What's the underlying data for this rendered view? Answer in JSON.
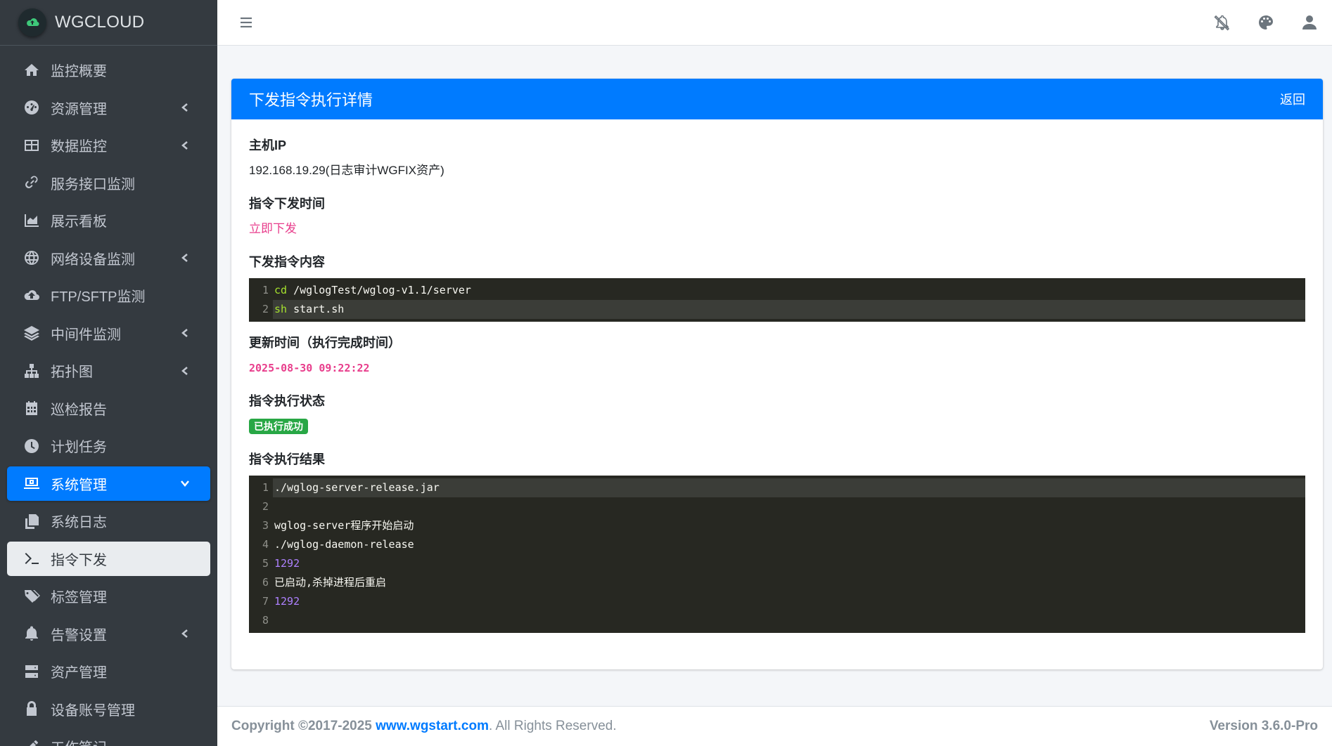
{
  "brand": {
    "name": "WGCLOUD"
  },
  "sidebar": {
    "items": [
      {
        "label": "监控概要",
        "icon": "home-icon",
        "arrow": false,
        "state": ""
      },
      {
        "label": "资源管理",
        "icon": "gauge-icon",
        "arrow": true,
        "state": ""
      },
      {
        "label": "数据监控",
        "icon": "table-icon",
        "arrow": true,
        "state": ""
      },
      {
        "label": "服务接口监测",
        "icon": "link-icon",
        "arrow": false,
        "state": ""
      },
      {
        "label": "展示看板",
        "icon": "area-chart-icon",
        "arrow": false,
        "state": ""
      },
      {
        "label": "网络设备监测",
        "icon": "globe-icon",
        "arrow": true,
        "state": ""
      },
      {
        "label": "FTP/SFTP监测",
        "icon": "cloud-upload-icon",
        "arrow": false,
        "state": ""
      },
      {
        "label": "中间件监测",
        "icon": "layers-icon",
        "arrow": true,
        "state": ""
      },
      {
        "label": "拓扑图",
        "icon": "sitemap-icon",
        "arrow": true,
        "state": ""
      },
      {
        "label": "巡检报告",
        "icon": "calendar-icon",
        "arrow": false,
        "state": ""
      },
      {
        "label": "计划任务",
        "icon": "clock-icon",
        "arrow": false,
        "state": ""
      },
      {
        "label": "系统管理",
        "icon": "laptop-icon",
        "arrow": true,
        "state": "active"
      },
      {
        "label": "系统日志",
        "icon": "copy-icon",
        "arrow": false,
        "state": ""
      },
      {
        "label": "指令下发",
        "icon": "terminal-icon",
        "arrow": false,
        "state": "current"
      },
      {
        "label": "标签管理",
        "icon": "tags-icon",
        "arrow": false,
        "state": ""
      },
      {
        "label": "告警设置",
        "icon": "bell-icon",
        "arrow": true,
        "state": ""
      },
      {
        "label": "资产管理",
        "icon": "server-icon",
        "arrow": false,
        "state": ""
      },
      {
        "label": "设备账号管理",
        "icon": "lock-icon",
        "arrow": false,
        "state": ""
      },
      {
        "label": "工作笔记",
        "icon": "edit-icon",
        "arrow": false,
        "state": ""
      }
    ]
  },
  "navbar": {
    "icons": [
      "menu-icon",
      "bell-slash-icon",
      "palette-icon",
      "user-icon"
    ]
  },
  "card": {
    "title": "下发指令执行详情",
    "back_label": "返回",
    "host_ip_label": "主机IP",
    "host_ip_value": "192.168.19.29(日志审计WGFIX资产)",
    "send_time_label": "指令下发时间",
    "send_time_value": "立即下发",
    "command_label": "下发指令内容",
    "command_lines": [
      {
        "n": "1",
        "kw": "cd",
        "rest": " /wglogTest/wglog-v1.1/server"
      },
      {
        "n": "2",
        "kw": "sh",
        "rest": " start.sh"
      }
    ],
    "update_time_label": "更新时间（执行完成时间）",
    "update_time_value": "2025-08-30 09:22:22",
    "status_label": "指令执行状态",
    "status_value": "已执行成功",
    "result_label": "指令执行结果",
    "result_lines": [
      {
        "n": "1",
        "text": "./wglog-server-release.jar",
        "num": false
      },
      {
        "n": "2",
        "text": "",
        "num": false
      },
      {
        "n": "3",
        "text": "wglog-server程序开始启动",
        "num": false
      },
      {
        "n": "4",
        "text": "./wglog-daemon-release",
        "num": false
      },
      {
        "n": "5",
        "text": "1292",
        "num": true
      },
      {
        "n": "6",
        "text": "已启动,杀掉进程后重启",
        "num": false
      },
      {
        "n": "7",
        "text": "1292",
        "num": true
      },
      {
        "n": "8",
        "text": "",
        "num": false
      }
    ]
  },
  "footer": {
    "copyright_prefix": "Copyright ©2017-2025",
    "link": "www.wgstart.com",
    "suffix": ". All Rights Reserved.",
    "version": "Version 3.6.0-Pro"
  },
  "colors": {
    "primary": "#007bff",
    "sidebar": "#343a40",
    "success": "#28a745",
    "pink": "#e83e8c"
  }
}
